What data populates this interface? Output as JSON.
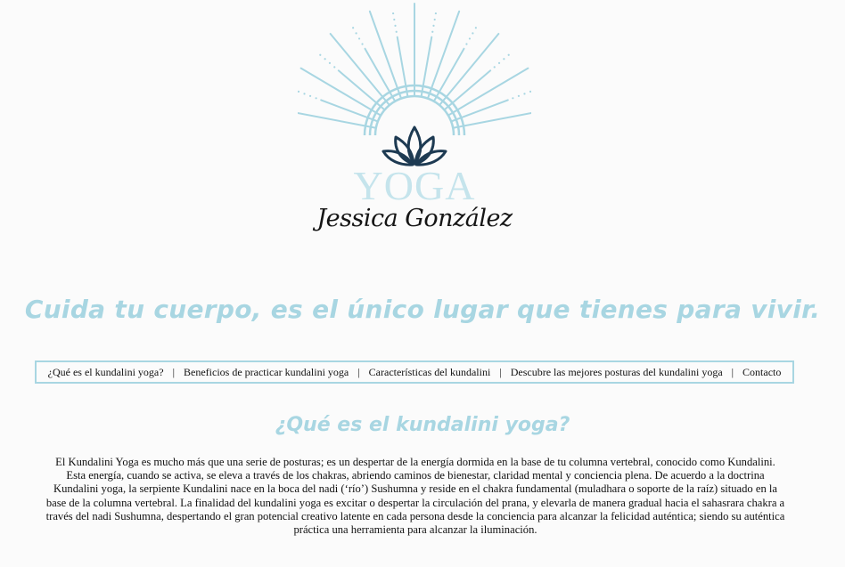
{
  "header": {
    "logo_word": "YOGA",
    "logo_signature": "Jessica González"
  },
  "tagline": "Cuida tu cuerpo, es el único lugar que tienes para vivir.",
  "nav": {
    "items": [
      {
        "label": "¿Qué es el kundalini yoga?"
      },
      {
        "label": "Beneficios de practicar kundalini yoga"
      },
      {
        "label": "Características del kundalini"
      },
      {
        "label": "Descubre las mejores posturas del kundalini yoga"
      },
      {
        "label": "Contacto"
      }
    ],
    "separator": "|"
  },
  "section": {
    "title": "¿Qué es el kundalini yoga?",
    "body": "El Kundalini Yoga es mucho más que una serie de posturas; es un despertar de la energía dormida en la base de tu columna vertebral, conocido como Kundalini. Esta energía, cuando se activa, se eleva a través de los chakras, abriendo caminos de bienestar, claridad mental y conciencia plena. De acuerdo a la doctrina Kundalini yoga, la serpiente Kundalini nace en la boca del nadi (‘río’) Sushumna y reside en el chakra fundamental (muladhara o soporte de la raíz) situado en la base de la columna vertebral. La finalidad del kundalini yoga es excitar o despertar la circulación del prana, y elevarla de manera gradual hacia el sahasrara chakra a través del nadi Sushumna, despertando el gran potencial creativo latente en cada persona desde la conciencia para alcanzar la felicidad auténtica; siendo su auténtica práctica una herramienta para alcanzar la iluminación."
  },
  "colors": {
    "accent": "#a8d6e2",
    "logo_light": "#c5e4ec",
    "lotus": "#1d3a52",
    "text": "#111111",
    "background": "#fbfbfb"
  },
  "icons": {
    "logo_rays": "sunburst-rays-icon",
    "logo_lotus": "lotus-icon"
  }
}
